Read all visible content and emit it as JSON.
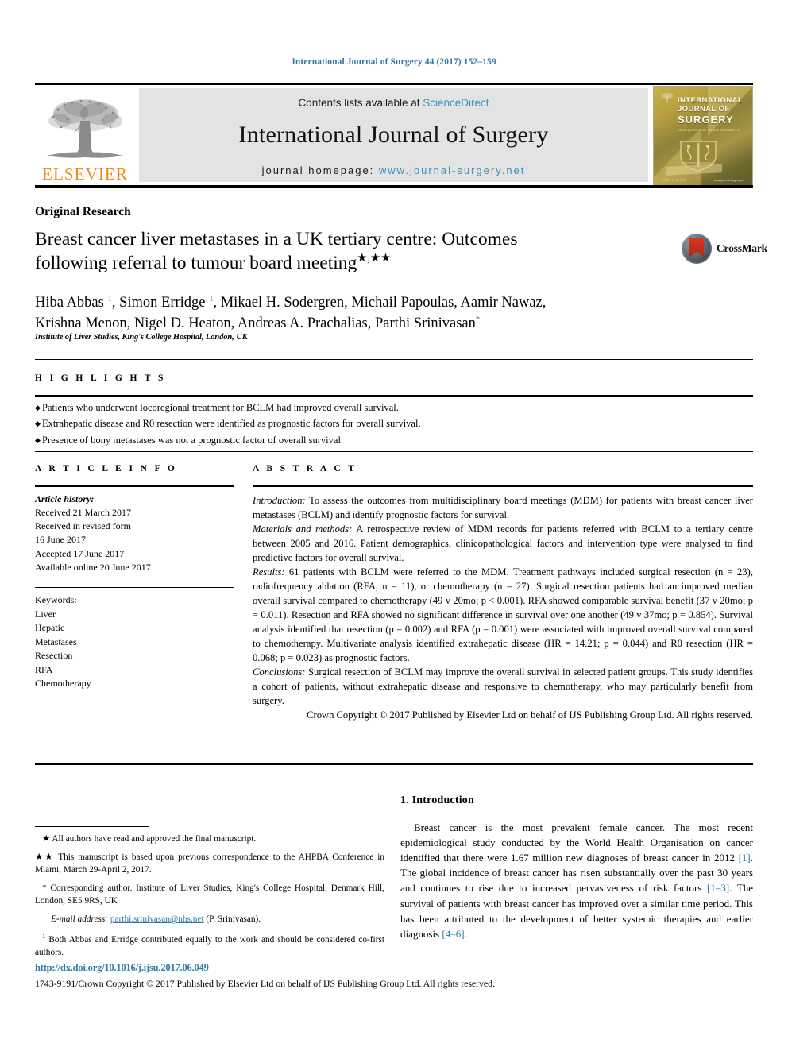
{
  "running_head": "International Journal of Surgery 44 (2017) 152–159",
  "masthead": {
    "contents_prefix": "Contents lists available at ",
    "sciencedirect": "ScienceDirect",
    "journal_title": "International Journal of Surgery",
    "homepage_prefix": "journal homepage: ",
    "homepage_url": "www.journal-surgery.net",
    "publisher_name": "ELSEVIER",
    "cover": {
      "line1": "INTERNATIONAL",
      "line2": "JOURNAL OF",
      "line3": "SURGERY",
      "subtitle": "Official journal of the Surgical Associates Ltd",
      "foot_left": "ISSN 1743-9191",
      "foot_right": "www.journal-surgery.net"
    }
  },
  "article": {
    "type_label": "Original Research",
    "title_line1": "Breast cancer liver metastases in a UK tertiary centre: Outcomes",
    "title_line2": "following referral to tumour board meeting",
    "title_marks": "★,★★",
    "crossmark_label": "CrossMark",
    "authors_line1": "Hiba Abbas 1, Simon Erridge 1, Mikael H. Sodergren, Michail Papoulas, Aamir Nawaz,",
    "authors_line2": "Krishna Menon, Nigel D. Heaton, Andreas A. Prachalias, Parthi Srinivasan *",
    "affiliation": "Institute of Liver Studies, King's College Hospital, London, UK"
  },
  "highlights": {
    "heading": "H I G H L I G H T S",
    "items": [
      "Patients who underwent locoregional treatment for BCLM had improved overall survival.",
      "Extrahepatic disease and R0 resection were identified as prognostic factors for overall survival.",
      "Presence of bony metastases was not a prognostic factor of overall survival."
    ]
  },
  "article_info": {
    "heading": "A R T I C L E   I N F O",
    "history_label": "Article history:",
    "history_lines": [
      "Received 21 March 2017",
      "Received in revised form",
      "16 June 2017",
      "Accepted 17 June 2017",
      "Available online 20 June 2017"
    ],
    "keywords_label": "Keywords:",
    "keywords": [
      "Liver",
      "Hepatic",
      "Metastases",
      "Resection",
      "RFA",
      "Chemotherapy"
    ]
  },
  "abstract": {
    "heading": "A B S T R A C T",
    "sections": [
      {
        "lead": "Introduction:",
        "text": " To assess the outcomes from multidisciplinary board meetings (MDM) for patients with breast cancer liver metastases (BCLM) and identify prognostic factors for survival."
      },
      {
        "lead": "Materials and methods:",
        "text": " A retrospective review of MDM records for patients referred with BCLM to a tertiary centre between 2005 and 2016. Patient demographics, clinicopathological factors and intervention type were analysed to find predictive factors for overall survival."
      },
      {
        "lead": "Results:",
        "text": " 61 patients with BCLM were referred to the MDM. Treatment pathways included surgical resection (n = 23), radiofrequency ablation (RFA, n = 11), or chemotherapy (n = 27). Surgical resection patients had an improved median overall survival compared to chemotherapy (49 v 20mo; p < 0.001). RFA showed comparable survival benefit (37 v 20mo; p = 0.011). Resection and RFA showed no significant difference in survival over one another (49 v 37mo; p = 0.854). Survival analysis identified that resection (p = 0.002) and RFA (p = 0.001) were associated with improved overall survival compared to chemotherapy. Multivariate analysis identified extrahepatic disease (HR = 14.21; p = 0.044) and R0 resection (HR = 0.068; p = 0.023) as prognostic factors."
      },
      {
        "lead": "Conclusions:",
        "text": " Surgical resection of BCLM may improve the overall survival in selected patient groups. This study identifies a cohort of patients, without extrahepatic disease and responsive to chemotherapy, who may particularly benefit from surgery."
      }
    ],
    "copyright": "Crown Copyright © 2017 Published by Elsevier Ltd on behalf of IJS Publishing Group Ltd. All rights reserved."
  },
  "footnotes": {
    "note_star": "★ All authors have read and approved the final manuscript.",
    "note_starstar": "★★ This manuscript is based upon previous correspondence to the AHPBA Conference in Miami, March 29-April 2, 2017.",
    "note_corresponding": "* Corresponding author. Institute of Liver Studies, King's College Hospital, Denmark Hill, London, SE5 9RS, UK",
    "email_label": "E-mail address:",
    "email_link": "parthi.srinivasan@nhs.net",
    "email_suffix": " (P. Srinivasan).",
    "note_equal_contrib_sup": "1",
    "note_equal_contrib": " Both Abbas and Erridge contributed equally to the work and should be considered co-first authors."
  },
  "introduction": {
    "heading": "1. Introduction",
    "paragraph_parts": [
      "Breast cancer is the most prevalent female cancer. The most recent epidemiological study conducted by the World Health Organisation on cancer identified that there were 1.67 million new diagnoses of breast cancer in 2012 ",
      "[1]",
      ". The global incidence of breast cancer has risen substantially over the past 30 years and continues to rise due to increased pervasiveness of risk factors ",
      "[1–3]",
      ". The survival of patients with breast cancer has improved over a similar time period. This has been attributed to the development of better systemic therapies and earlier diagnosis ",
      "[4–6]",
      "."
    ]
  },
  "footer": {
    "doi": "http://dx.doi.org/10.1016/j.ijsu.2017.06.049",
    "copyright": "1743-9191/Crown Copyright © 2017 Published by Elsevier Ltd on behalf of IJS Publishing Group Ltd. All rights reserved."
  },
  "colors": {
    "link_blue": "#2e7ba6",
    "sciencedirect_blue": "#3f8fba",
    "elsevier_orange": "#f08a1c",
    "crossmark_red": "#c62f1c"
  }
}
